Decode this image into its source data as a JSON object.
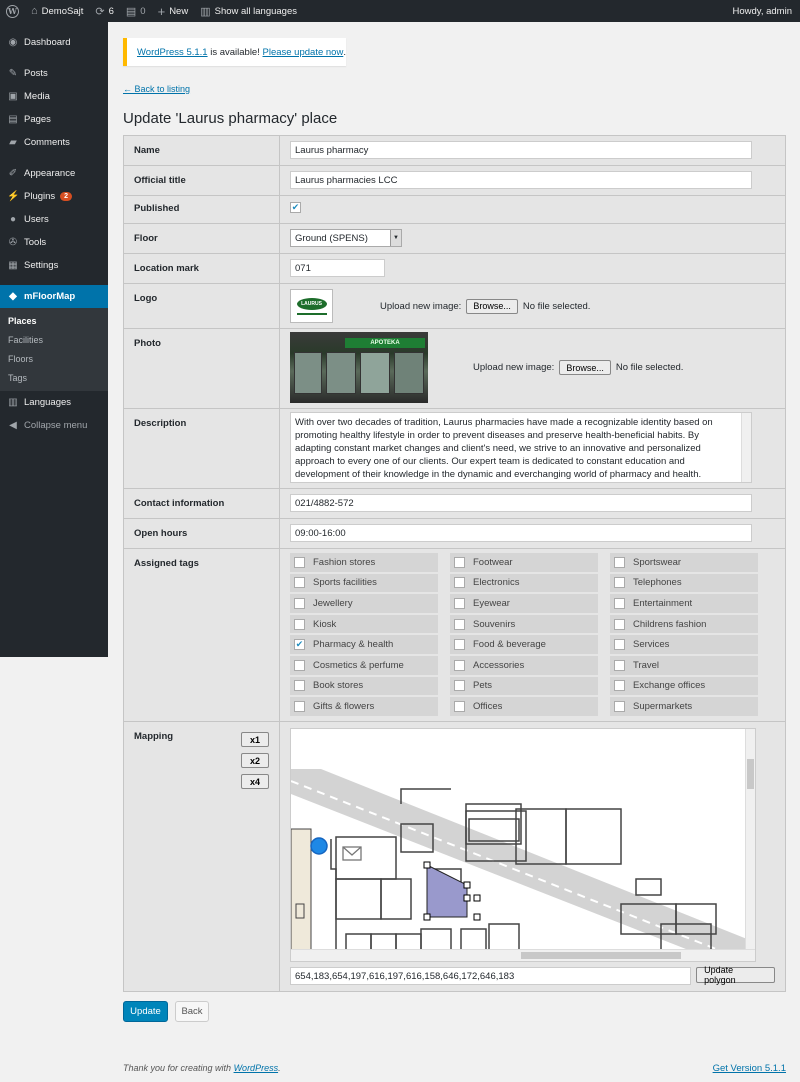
{
  "adminbar": {
    "site_name": "DemoSajt",
    "updates_count": "6",
    "comments_count": "0",
    "new_label": "New",
    "languages_label": "Show all languages",
    "howdy": "Howdy, admin"
  },
  "sidebar": {
    "items": [
      {
        "label": "Dashboard",
        "icon": "dashboard-icon"
      },
      {
        "label": "Posts",
        "icon": "pin-icon"
      },
      {
        "label": "Media",
        "icon": "media-icon"
      },
      {
        "label": "Pages",
        "icon": "pages-icon"
      },
      {
        "label": "Comments",
        "icon": "comment-icon"
      },
      {
        "label": "Appearance",
        "icon": "brush-icon"
      },
      {
        "label": "Plugins",
        "icon": "plugin-icon",
        "badge": "2"
      },
      {
        "label": "Users",
        "icon": "user-icon"
      },
      {
        "label": "Tools",
        "icon": "wrench-icon"
      },
      {
        "label": "Settings",
        "icon": "settings-icon"
      },
      {
        "label": "mFloorMap",
        "icon": "map-icon"
      },
      {
        "label": "Languages",
        "icon": "translate-icon"
      },
      {
        "label": "Collapse menu",
        "icon": "collapse-icon"
      }
    ],
    "submenu": [
      "Places",
      "Facilities",
      "Floors",
      "Tags"
    ]
  },
  "notice": {
    "link1": "WordPress 5.1.1",
    "middle": " is available! ",
    "link2": "Please update now",
    "end": "."
  },
  "back_link": "← Back to listing",
  "page_title": "Update 'Laurus pharmacy' place",
  "form": {
    "name_label": "Name",
    "name_value": "Laurus pharmacy",
    "official_label": "Official title",
    "official_value": "Laurus pharmacies LCC",
    "published_label": "Published",
    "published": true,
    "floor_label": "Floor",
    "floor_value": "Ground (SPENS)",
    "location_label": "Location mark",
    "location_value": "071",
    "logo_label": "Logo",
    "logo_text": "LAURUS",
    "upload_label": "Upload new image:",
    "browse_label": "Browse...",
    "no_file": "No file selected.",
    "photo_label": "Photo",
    "photo_sign": "APOTEKA",
    "description_label": "Description",
    "description_value": "With over two decades of tradition, Laurus pharmacies have made a recognizable identity based on promoting healthy lifestyle in order to prevent diseases and preserve health-beneficial habits. By adapting constant market changes and client's need, we strive to an innovative and personalized approach to every one of our clients. Our expert team is dedicated to constant education and development of their knowledge in the dynamic and everchanging world of pharmacy and health.",
    "contact_label": "Contact information",
    "contact_value": "021/4882-572",
    "hours_label": "Open hours",
    "hours_value": "09:00-16:00",
    "tags_label": "Assigned tags",
    "mapping_label": "Mapping",
    "zoom": [
      "x1",
      "x2",
      "x4"
    ],
    "polygon_value": "654,183,654,197,616,197,616,158,646,172,646,183",
    "update_polygon": "Update polygon"
  },
  "tags": [
    {
      "label": "Fashion stores",
      "checked": false
    },
    {
      "label": "Footwear",
      "checked": false
    },
    {
      "label": "Sportswear",
      "checked": false
    },
    {
      "label": "Sports facilities",
      "checked": false
    },
    {
      "label": "Electronics",
      "checked": false
    },
    {
      "label": "Telephones",
      "checked": false
    },
    {
      "label": "Jewellery",
      "checked": false
    },
    {
      "label": "Eyewear",
      "checked": false
    },
    {
      "label": "Entertainment",
      "checked": false
    },
    {
      "label": "Kiosk",
      "checked": false
    },
    {
      "label": "Souvenirs",
      "checked": false
    },
    {
      "label": "Childrens fashion",
      "checked": false
    },
    {
      "label": "Pharmacy & health",
      "checked": true
    },
    {
      "label": "Food & beverage",
      "checked": false
    },
    {
      "label": "Services",
      "checked": false
    },
    {
      "label": "Cosmetics & perfume",
      "checked": false
    },
    {
      "label": "Accessories",
      "checked": false
    },
    {
      "label": "Travel",
      "checked": false
    },
    {
      "label": "Book stores",
      "checked": false
    },
    {
      "label": "Pets",
      "checked": false
    },
    {
      "label": "Exchange offices",
      "checked": false
    },
    {
      "label": "Gifts & flowers",
      "checked": false
    },
    {
      "label": "Offices",
      "checked": false
    },
    {
      "label": "Supermarkets",
      "checked": false
    }
  ],
  "buttons": {
    "update": "Update",
    "back": "Back"
  },
  "footer": {
    "left_prefix": "Thank you for creating with ",
    "left_link": "WordPress",
    "left_suffix": ".",
    "right": "Get Version 5.1.1"
  },
  "colors": {
    "accent": "#0073aa",
    "primary_button": "#0085ba",
    "notice": "#ffb900",
    "badge": "#d54e21",
    "polygon": "#9999cc"
  }
}
